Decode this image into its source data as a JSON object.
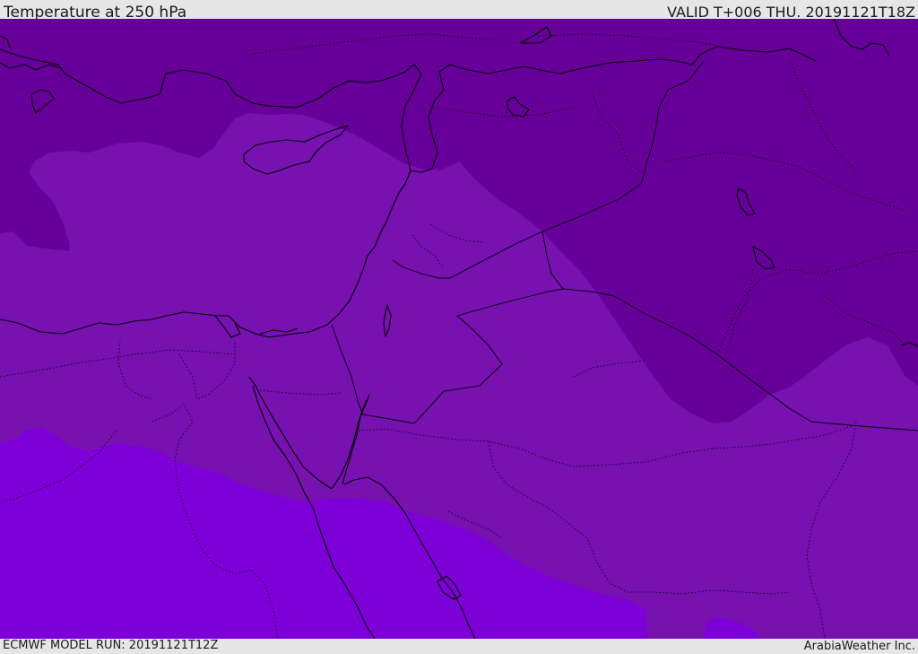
{
  "header": {
    "title": "Temperature at 250 hPa",
    "valid": "VALID T+006 THU. 20191121T18Z"
  },
  "footer": {
    "model_run": "ECMWF MODEL RUN: 20191121T12Z",
    "credit": "ArabiaWeather Inc."
  },
  "colors": {
    "dark_band": "#660099",
    "mid_band": "#7711b0",
    "light_band": "#7e00d8",
    "coastline": "#000000"
  },
  "map": {
    "parameter": "Temperature",
    "level": "250 hPa"
  }
}
